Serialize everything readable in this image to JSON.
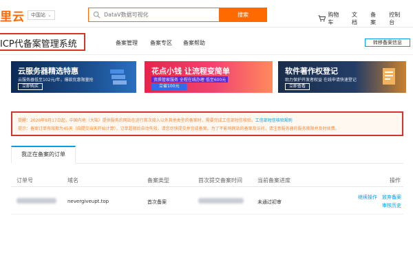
{
  "topbar": {
    "logo": "里云",
    "region": "中国站",
    "search_placeholder": "DataV数据可视化",
    "search_button": "搜索",
    "nav": [
      "购物车",
      "文档",
      "备案",
      "控制台"
    ]
  },
  "subheader": {
    "title": "ICP代备案管理系统",
    "nav": [
      "备案管理",
      "备案专区",
      "备案帮助"
    ],
    "transfer_button": "转移备案信息"
  },
  "banners": [
    {
      "title": "云服务器精选特惠",
      "subtitle": "云服务器低至102元/年，爆款优惠限量抢",
      "button": "立即购买"
    },
    {
      "title": "花点小钱 让流程变简单",
      "subtitle": "资质管家服务 全程在线办理 低至600元",
      "button": "立省100元"
    },
    {
      "title": "软件著作权登记",
      "subtitle": "助力保护开发者权益 在线申请快速登记",
      "button": "立即查看"
    }
  ],
  "notice": {
    "line1": "提醒：2020年8月17日起，中国内地（大陆）提供服务的网站在进行首次接入以外其他类型的备案时，需要完成工信部短信核验。",
    "line1_link": "工信部短信核验规则",
    "line2": "提示：备案订单有效期为45天（自提交当天开始计算），订单超期后自动失效，请您尽快提交并完成备案。为了不影响网站的备案及访问，请注意服务器的服务期限并及时续费。"
  },
  "tab": {
    "label": "我正在备案的订单"
  },
  "table": {
    "headers": [
      "订单号",
      "域名",
      "备案类型",
      "首次提交备案时间",
      "当前备案进度",
      "操作"
    ],
    "row": {
      "domain": "nevergiveupt.top",
      "type": "首次备案",
      "progress": "未通过初审",
      "actions": [
        "继续操作",
        "放弃备案",
        "审核历史"
      ]
    }
  },
  "colors": {
    "accent": "#ff6a00",
    "link": "#00a0e9",
    "highlight": "#d9302c"
  }
}
